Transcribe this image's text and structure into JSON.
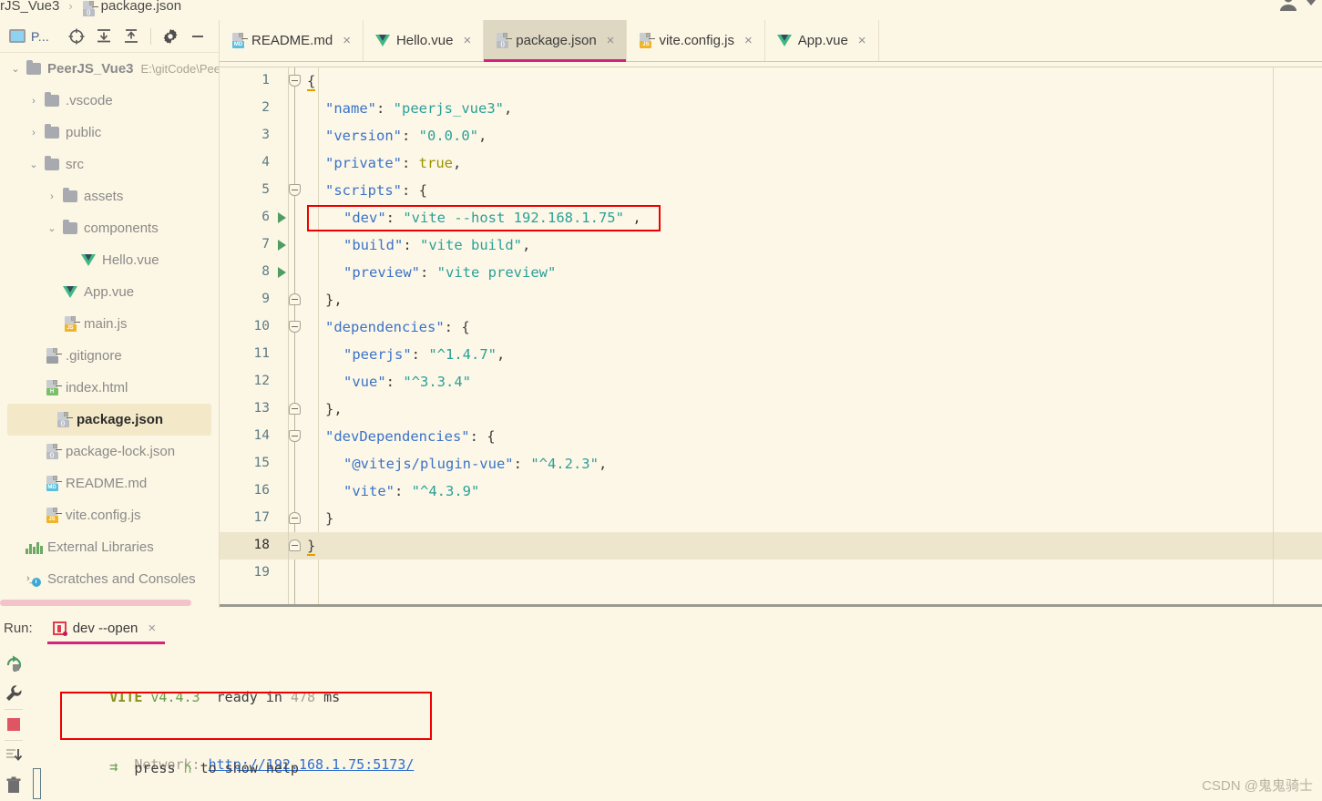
{
  "breadcrumb": {
    "project": "rJS_Vue3",
    "separator": "›",
    "file": "package.json",
    "file_icon": "json-file-icon"
  },
  "account": {
    "icon": "account-icon",
    "chevron": "chevron-down-icon"
  },
  "project_panel": {
    "title": "P...",
    "title_icon": "project-window-icon",
    "toolbar": [
      {
        "name": "select-opened-file-icon",
        "glyph": "target-icon"
      },
      {
        "name": "expand-all-icon",
        "glyph": "expand-all-icon"
      },
      {
        "name": "collapse-all-icon",
        "glyph": "collapse-all-icon"
      },
      {
        "name": "settings-icon",
        "glyph": "gear-icon"
      },
      {
        "name": "hide-icon",
        "glyph": "minus-icon"
      }
    ],
    "tree": [
      {
        "label": "PeerJS_Vue3",
        "sub": "E:\\gitCode\\Pee",
        "type": "root",
        "arrow": "down",
        "depth": 0
      },
      {
        "label": ".vscode",
        "type": "folder",
        "arrow": "right",
        "depth": 1
      },
      {
        "label": "public",
        "type": "folder",
        "arrow": "right",
        "depth": 1
      },
      {
        "label": "src",
        "type": "folder",
        "arrow": "down",
        "depth": 1
      },
      {
        "label": "assets",
        "type": "folder",
        "arrow": "right",
        "depth": 2
      },
      {
        "label": "components",
        "type": "folder",
        "arrow": "down",
        "depth": 2
      },
      {
        "label": "Hello.vue",
        "type": "vue",
        "arrow": "none",
        "depth": 3
      },
      {
        "label": "App.vue",
        "type": "vue",
        "arrow": "none",
        "depth": 2
      },
      {
        "label": "main.js",
        "type": "file",
        "badge": "JS",
        "badge_color": "#f0b429",
        "arrow": "none",
        "depth": 2
      },
      {
        "label": ".gitignore",
        "type": "file",
        "badge": "",
        "badge_color": "#9aa0a6",
        "arrow": "none",
        "depth": 1
      },
      {
        "label": "index.html",
        "type": "file",
        "badge": "H",
        "badge_color": "#7cbf6a",
        "arrow": "none",
        "depth": 1
      },
      {
        "label": "package.json",
        "type": "file",
        "badge": "{}",
        "badge_color": "#b9bcc2",
        "arrow": "none",
        "depth": 1,
        "selected": true
      },
      {
        "label": "package-lock.json",
        "type": "file",
        "badge": "{}",
        "badge_color": "#b9bcc2",
        "arrow": "none",
        "depth": 1
      },
      {
        "label": "README.md",
        "type": "file",
        "badge": "MD",
        "badge_color": "#5bc0de",
        "arrow": "none",
        "depth": 1
      },
      {
        "label": "vite.config.js",
        "type": "file",
        "badge": "JS",
        "badge_color": "#f0b429",
        "arrow": "none",
        "depth": 1
      },
      {
        "label": "External Libraries",
        "type": "libs",
        "arrow": "none",
        "depth": 0
      },
      {
        "label": "Scratches and Consoles",
        "type": "scratches",
        "arrow": "none",
        "depth": 0
      }
    ]
  },
  "tabs": [
    {
      "label": "README.md",
      "icon": "md-file-icon",
      "badge": "MD",
      "badge_color": "#5bc0de",
      "active": false
    },
    {
      "label": "Hello.vue",
      "icon": "vue-file-icon",
      "active": false
    },
    {
      "label": "package.json",
      "icon": "json-file-icon",
      "badge": "{}",
      "badge_color": "#b9bcc2",
      "active": true
    },
    {
      "label": "vite.config.js",
      "icon": "js-file-icon",
      "badge": "JS",
      "badge_color": "#f0b429",
      "active": false
    },
    {
      "label": "App.vue",
      "icon": "vue-file-icon",
      "active": false
    }
  ],
  "editor": {
    "active_tab_accent": "#d6217f",
    "current_line": 18,
    "highlight_box_color": "#ee0000",
    "lines": [
      {
        "n": 1,
        "fold": "open",
        "runmark": false,
        "tokens": [
          {
            "t": "{",
            "c": "p"
          }
        ],
        "indent": 0
      },
      {
        "n": 2,
        "fold": null,
        "runmark": false,
        "tokens": [
          {
            "t": "\"name\"",
            "c": "k"
          },
          {
            "t": ": ",
            "c": "p"
          },
          {
            "t": "\"peerjs_vue3\"",
            "c": "s"
          },
          {
            "t": ",",
            "c": "p"
          }
        ],
        "indent": 1
      },
      {
        "n": 3,
        "fold": null,
        "runmark": false,
        "tokens": [
          {
            "t": "\"version\"",
            "c": "k"
          },
          {
            "t": ": ",
            "c": "p"
          },
          {
            "t": "\"0.0.0\"",
            "c": "s"
          },
          {
            "t": ",",
            "c": "p"
          }
        ],
        "indent": 1
      },
      {
        "n": 4,
        "fold": null,
        "runmark": false,
        "tokens": [
          {
            "t": "\"private\"",
            "c": "k"
          },
          {
            "t": ": ",
            "c": "p"
          },
          {
            "t": "true",
            "c": "b"
          },
          {
            "t": ",",
            "c": "p"
          }
        ],
        "indent": 1
      },
      {
        "n": 5,
        "fold": "open",
        "runmark": false,
        "tokens": [
          {
            "t": "\"scripts\"",
            "c": "k"
          },
          {
            "t": ": {",
            "c": "p"
          }
        ],
        "indent": 1
      },
      {
        "n": 6,
        "fold": null,
        "runmark": true,
        "tokens": [
          {
            "t": "\"dev\"",
            "c": "k"
          },
          {
            "t": ": ",
            "c": "p"
          },
          {
            "t": "\"vite --host 192.168.1.75\"",
            "c": "s"
          },
          {
            "t": " ,",
            "c": "p"
          }
        ],
        "indent": 2
      },
      {
        "n": 7,
        "fold": null,
        "runmark": true,
        "tokens": [
          {
            "t": "\"build\"",
            "c": "k"
          },
          {
            "t": ": ",
            "c": "p"
          },
          {
            "t": "\"vite build\"",
            "c": "s"
          },
          {
            "t": ",",
            "c": "p"
          }
        ],
        "indent": 2
      },
      {
        "n": 8,
        "fold": null,
        "runmark": true,
        "tokens": [
          {
            "t": "\"preview\"",
            "c": "k"
          },
          {
            "t": ": ",
            "c": "p"
          },
          {
            "t": "\"vite preview\"",
            "c": "s"
          }
        ],
        "indent": 2
      },
      {
        "n": 9,
        "fold": "close",
        "runmark": false,
        "tokens": [
          {
            "t": "},",
            "c": "p"
          }
        ],
        "indent": 1
      },
      {
        "n": 10,
        "fold": "open",
        "runmark": false,
        "tokens": [
          {
            "t": "\"dependencies\"",
            "c": "k"
          },
          {
            "t": ": {",
            "c": "p"
          }
        ],
        "indent": 1
      },
      {
        "n": 11,
        "fold": null,
        "runmark": false,
        "tokens": [
          {
            "t": "\"peerjs\"",
            "c": "k"
          },
          {
            "t": ": ",
            "c": "p"
          },
          {
            "t": "\"^1.4.7\"",
            "c": "s"
          },
          {
            "t": ",",
            "c": "p"
          }
        ],
        "indent": 2
      },
      {
        "n": 12,
        "fold": null,
        "runmark": false,
        "tokens": [
          {
            "t": "\"vue\"",
            "c": "k"
          },
          {
            "t": ": ",
            "c": "p"
          },
          {
            "t": "\"^3.3.4\"",
            "c": "s"
          }
        ],
        "indent": 2
      },
      {
        "n": 13,
        "fold": "close",
        "runmark": false,
        "tokens": [
          {
            "t": "},",
            "c": "p"
          }
        ],
        "indent": 1
      },
      {
        "n": 14,
        "fold": "open",
        "runmark": false,
        "tokens": [
          {
            "t": "\"devDependencies\"",
            "c": "k"
          },
          {
            "t": ": {",
            "c": "p"
          }
        ],
        "indent": 1
      },
      {
        "n": 15,
        "fold": null,
        "runmark": false,
        "tokens": [
          {
            "t": "\"@vitejs/plugin-vue\"",
            "c": "k"
          },
          {
            "t": ": ",
            "c": "p"
          },
          {
            "t": "\"^4.2.3\"",
            "c": "s"
          },
          {
            "t": ",",
            "c": "p"
          }
        ],
        "indent": 2
      },
      {
        "n": 16,
        "fold": null,
        "runmark": false,
        "tokens": [
          {
            "t": "\"vite\"",
            "c": "k"
          },
          {
            "t": ": ",
            "c": "p"
          },
          {
            "t": "\"^4.3.9\"",
            "c": "s"
          }
        ],
        "indent": 2
      },
      {
        "n": 17,
        "fold": "close",
        "runmark": false,
        "tokens": [
          {
            "t": "}",
            "c": "p"
          }
        ],
        "indent": 1
      },
      {
        "n": 18,
        "fold": "close",
        "runmark": false,
        "tokens": [
          {
            "t": "}",
            "c": "p"
          }
        ],
        "indent": 0,
        "current": true
      },
      {
        "n": 19,
        "fold": null,
        "runmark": false,
        "tokens": [],
        "indent": 0
      }
    ]
  },
  "run_panel": {
    "label": "Run:",
    "tab": {
      "label": "dev --open",
      "icon": "run-config-icon",
      "close": "×",
      "accent": "#d6217f"
    },
    "side_buttons": [
      {
        "name": "rerun-icon",
        "glyph": "rerun"
      },
      {
        "name": "settings-wrench-icon",
        "glyph": "wrench"
      },
      {
        "name": "stop-icon",
        "glyph": "stop"
      },
      {
        "name": "scroll-to-end-icon",
        "glyph": "scroll-end"
      },
      {
        "name": "clear-all-icon",
        "glyph": "trash"
      }
    ],
    "console": {
      "line1": {
        "vite": "VITE",
        "version": "v4.4.3",
        "ready": "ready in",
        "ms": "478",
        "unit": "ms"
      },
      "line2": {
        "arrow": "→",
        "label": "Network:",
        "url": "http://192.168.1.75:5173/"
      },
      "line3": {
        "arrow": "→",
        "pre": "press",
        "key": "h",
        "post": "to show help"
      }
    }
  },
  "watermark": "CSDN @鬼鬼骑士"
}
